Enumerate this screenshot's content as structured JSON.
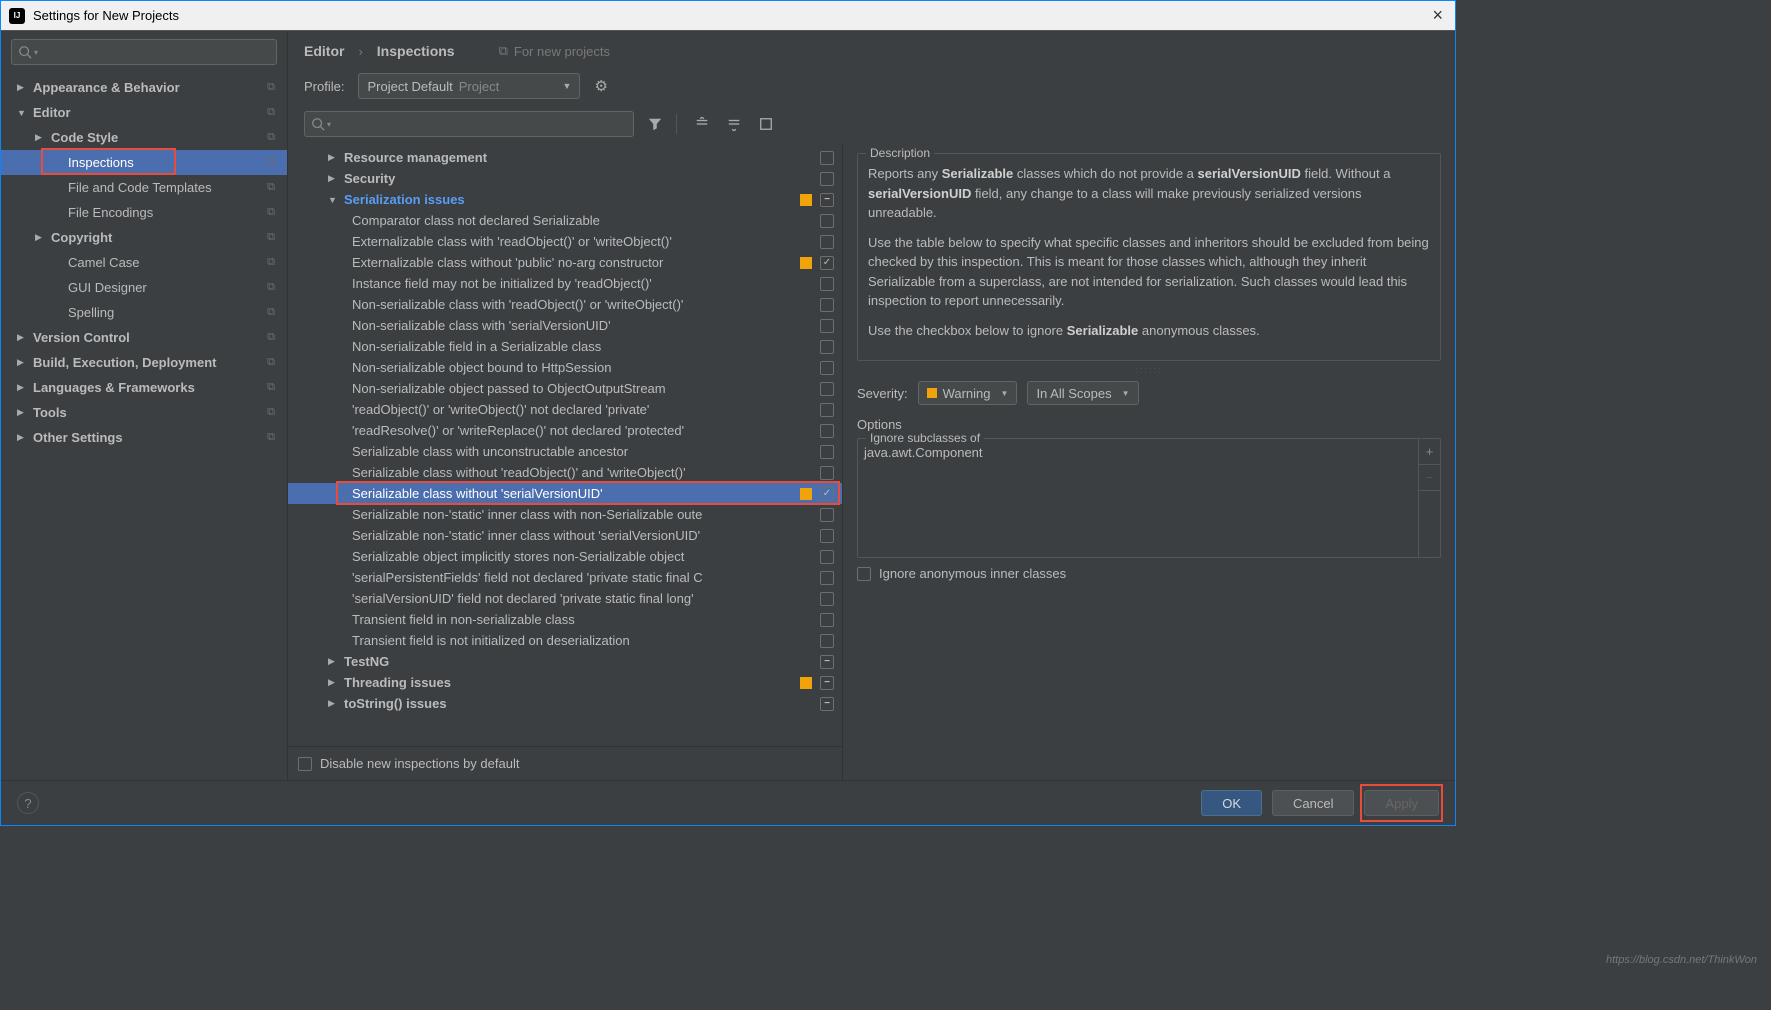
{
  "title": "Settings for New Projects",
  "sidebar": {
    "items": [
      {
        "label": "Appearance & Behavior",
        "arrow": "▶",
        "level": 0,
        "copy": true
      },
      {
        "label": "Editor",
        "arrow": "▼",
        "level": 0,
        "copy": true
      },
      {
        "label": "Code Style",
        "arrow": "▶",
        "level": 1,
        "copy": true
      },
      {
        "label": "Inspections",
        "level": 2,
        "copy": true,
        "selected": true,
        "redbox": true
      },
      {
        "label": "File and Code Templates",
        "level": 2,
        "copy": true
      },
      {
        "label": "File Encodings",
        "level": 2,
        "copy": true
      },
      {
        "label": "Copyright",
        "arrow": "▶",
        "level": 1,
        "copy": true
      },
      {
        "label": "Camel Case",
        "level": 2,
        "copy": true
      },
      {
        "label": "GUI Designer",
        "level": 2,
        "copy": true
      },
      {
        "label": "Spelling",
        "level": 2,
        "copy": true
      },
      {
        "label": "Version Control",
        "arrow": "▶",
        "level": 0,
        "copy": true
      },
      {
        "label": "Build, Execution, Deployment",
        "arrow": "▶",
        "level": 0,
        "copy": true
      },
      {
        "label": "Languages & Frameworks",
        "arrow": "▶",
        "level": 0,
        "copy": true
      },
      {
        "label": "Tools",
        "arrow": "▶",
        "level": 0,
        "copy": true
      },
      {
        "label": "Other Settings",
        "arrow": "▶",
        "level": 0,
        "copy": true
      }
    ]
  },
  "breadcrumb": {
    "a": "Editor",
    "b": "Inspections",
    "hint": "For new projects"
  },
  "profile": {
    "label": "Profile:",
    "name": "Project Default",
    "scope": "Project"
  },
  "tree": [
    {
      "type": "group",
      "arrow": "▶",
      "label": "Resource management",
      "cb": ""
    },
    {
      "type": "group",
      "arrow": "▶",
      "label": "Security",
      "cb": ""
    },
    {
      "type": "group",
      "arrow": "▼",
      "label": "Serialization issues",
      "cb": "mixed",
      "sq": true,
      "blue": true
    },
    {
      "type": "leaf",
      "label": "Comparator class not declared Serializable",
      "cb": ""
    },
    {
      "type": "leaf",
      "label": "Externalizable class with 'readObject()' or 'writeObject()'",
      "cb": ""
    },
    {
      "type": "leaf",
      "label": "Externalizable class without 'public' no-arg constructor",
      "cb": "checked",
      "sq": true
    },
    {
      "type": "leaf",
      "label": "Instance field may not be initialized by 'readObject()'",
      "cb": ""
    },
    {
      "type": "leaf",
      "label": "Non-serializable class with 'readObject()' or 'writeObject()'",
      "cb": ""
    },
    {
      "type": "leaf",
      "label": "Non-serializable class with 'serialVersionUID'",
      "cb": ""
    },
    {
      "type": "leaf",
      "label": "Non-serializable field in a Serializable class",
      "cb": ""
    },
    {
      "type": "leaf",
      "label": "Non-serializable object bound to HttpSession",
      "cb": ""
    },
    {
      "type": "leaf",
      "label": "Non-serializable object passed to ObjectOutputStream",
      "cb": ""
    },
    {
      "type": "leaf",
      "label": "'readObject()' or 'writeObject()' not declared 'private'",
      "cb": ""
    },
    {
      "type": "leaf",
      "label": "'readResolve()' or 'writeReplace()' not declared 'protected'",
      "cb": ""
    },
    {
      "type": "leaf",
      "label": "Serializable class with unconstructable ancestor",
      "cb": ""
    },
    {
      "type": "leaf",
      "label": "Serializable class without 'readObject()' and 'writeObject()'",
      "cb": ""
    },
    {
      "type": "leaf",
      "label": "Serializable class without 'serialVersionUID'",
      "cb": "checked",
      "sq": true,
      "sel": true,
      "redbox": true
    },
    {
      "type": "leaf",
      "label": "Serializable non-'static' inner class with non-Serializable oute",
      "cb": ""
    },
    {
      "type": "leaf",
      "label": "Serializable non-'static' inner class without 'serialVersionUID'",
      "cb": ""
    },
    {
      "type": "leaf",
      "label": "Serializable object implicitly stores non-Serializable object",
      "cb": ""
    },
    {
      "type": "leaf",
      "label": "'serialPersistentFields' field not declared 'private static final C",
      "cb": ""
    },
    {
      "type": "leaf",
      "label": "'serialVersionUID' field not declared 'private static final long'",
      "cb": ""
    },
    {
      "type": "leaf",
      "label": "Transient field in non-serializable class",
      "cb": ""
    },
    {
      "type": "leaf",
      "label": "Transient field is not initialized on deserialization",
      "cb": ""
    },
    {
      "type": "group",
      "arrow": "▶",
      "label": "TestNG",
      "cb": "mixed"
    },
    {
      "type": "group",
      "arrow": "▶",
      "label": "Threading issues",
      "cb": "mixed",
      "sq": true
    },
    {
      "type": "group",
      "arrow": "▶",
      "label": "toString() issues",
      "cb": "mixed"
    }
  ],
  "disable_label": "Disable new inspections by default",
  "desc_title": "Description",
  "desc": {
    "p1a": "Reports any ",
    "p1b": "Serializable",
    "p1c": " classes which do not provide a ",
    "p1d": "serialVersionUID",
    "p1e": " field. Without a ",
    "p1f": "serialVersionUID",
    "p1g": " field, any change to a class will make previously serialized versions unreadable.",
    "p2": "Use the table below to specify what specific classes and inheritors should be excluded from being checked by this inspection. This is meant for those classes which, although they inherit Serializable from a superclass, are not intended for serialization. Such classes would lead this inspection to report unnecessarily.",
    "p3a": "Use the checkbox below to ignore ",
    "p3b": "Serializable",
    "p3c": " anonymous classes."
  },
  "severity": {
    "label": "Severity:",
    "value": "Warning",
    "scope": "In All Scopes"
  },
  "options_label": "Options",
  "subclass": {
    "legend": "Ignore subclasses of",
    "value": "java.awt.Component"
  },
  "ignore_anon": "Ignore anonymous inner classes",
  "buttons": {
    "ok": "OK",
    "cancel": "Cancel",
    "apply": "Apply"
  },
  "watermark": "https://blog.csdn.net/ThinkWon"
}
